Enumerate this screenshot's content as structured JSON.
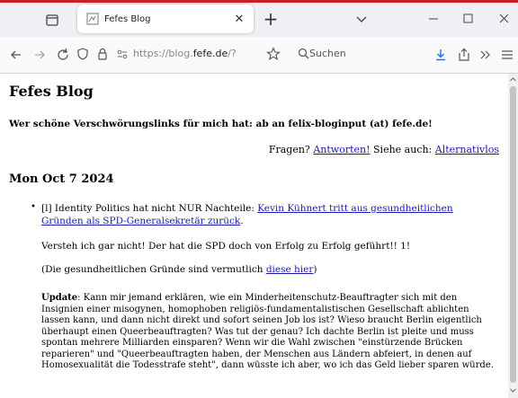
{
  "browser": {
    "tab_title": "Fefes Blog",
    "url_prefix": "https://blog.",
    "url_host": "fefe.de",
    "url_suffix": "/?",
    "search_placeholder": "Suchen"
  },
  "page": {
    "title": "Fefes Blog",
    "tagline": "Wer schöne Verschwörungslinks für mich hat: ab an felix-bloginput (at) fefe.de!",
    "links_prefix": "Fragen?",
    "link_answers": "Antworten!",
    "links_mid": "Siehe auch:",
    "link_alternatives": "Alternativlos",
    "date_heading": "Mon Oct 7 2024",
    "post": {
      "permalink": "[l]",
      "intro": "Identity Politics hat nicht NUR Nachteile:",
      "headline_link": "Kevin Kühnert tritt aus gesundheitlichen Gründen als SPD-Generalsekretär zurück",
      "headline_end": ".",
      "p2": "Versteh ich gar nicht! Der hat die SPD doch von Erfolg zu Erfolg geführt!! 1!",
      "p3_prefix": "(Die gesundheitlichen Gründe sind vermutlich",
      "p3_link": "diese hier",
      "p3_suffix": ")",
      "update_label": "Update",
      "update_text": ": Kann mir jemand erklären, wie ein Minderheitenschutz-Beauftragter sich mit den Insignien einer misogynen, homophoben religiös-fundamentalistischen Gesellschaft ablichten lassen kann, und dann nicht direkt und sofort seinen Job los ist? Wieso braucht Berlin eigentlich überhaupt einen Queerbeauftragten? Was tut der genau? Ich dachte Berlin ist pleite und muss spontan mehrere Milliarden einsparen? Wenn wir die Wahl zwischen \"einstürzende Brücken reparieren\" und \"Queerbeauftragten haben, der Menschen aus Ländern abfeiert, in denen auf Homosexualität die Todesstrafe steht\", dann wüsste ich aber, wo ich das Geld lieber sparen würde."
    }
  },
  "colors": {
    "link": "#1a1aa8",
    "chrome": "#f0f0f4"
  }
}
